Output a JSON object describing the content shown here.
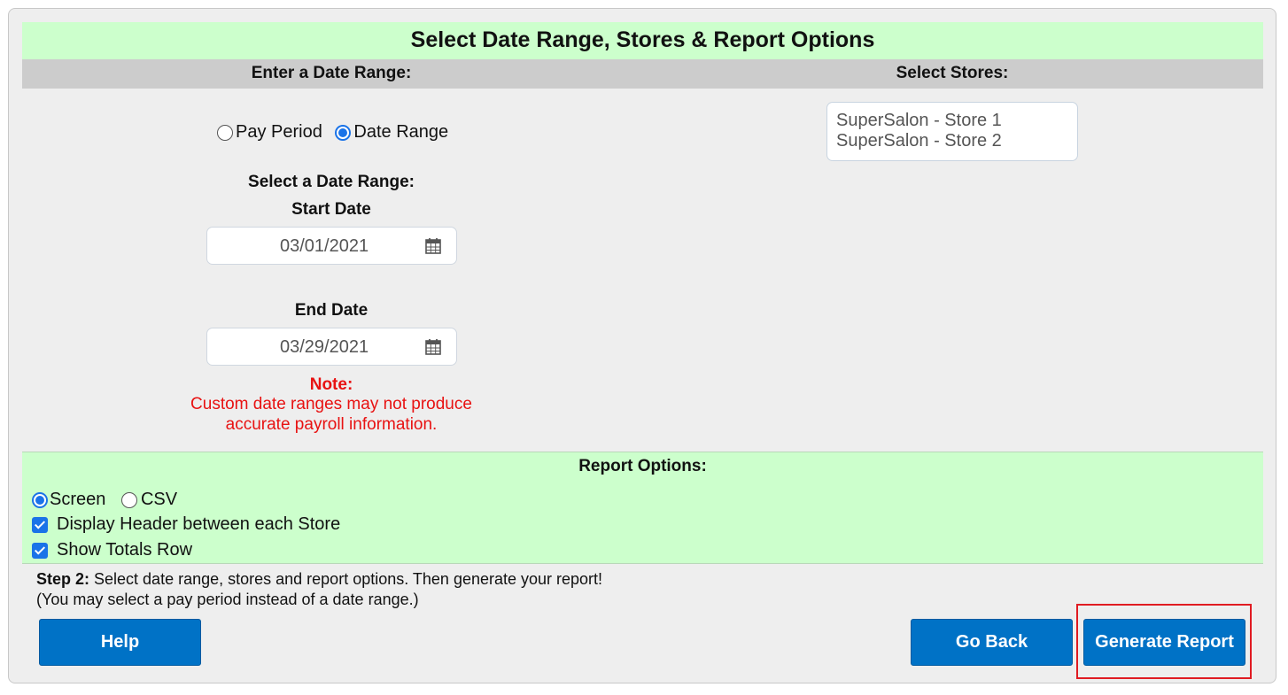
{
  "title": "Select Date Range, Stores & Report Options",
  "date_section": {
    "header": "Enter a Date Range:",
    "mode_options": [
      {
        "label": "Pay Period",
        "selected": false
      },
      {
        "label": "Date Range",
        "selected": true
      }
    ],
    "select_label": "Select a Date Range:",
    "start_label": "Start Date",
    "start_value": "03/01/2021",
    "end_label": "End Date",
    "end_value": "03/29/2021",
    "note_title": "Note:",
    "note_line1": "Custom date ranges may not produce",
    "note_line2": "accurate payroll information.",
    "note_color": "#e81212"
  },
  "stores_section": {
    "header": "Select Stores:",
    "stores": [
      "SuperSalon - Store 1",
      "SuperSalon - Store 2"
    ]
  },
  "report_options": {
    "header": "Report Options:",
    "output_formats": [
      {
        "label": "Screen",
        "selected": true
      },
      {
        "label": "CSV",
        "selected": false
      }
    ],
    "checkboxes": [
      {
        "label": "Display Header between each Store",
        "checked": true
      },
      {
        "label": "Show Totals Row",
        "checked": true
      }
    ]
  },
  "instructions": {
    "step_label": "Step 2:",
    "step_text": " Select date range, stores and report options. Then generate your report!",
    "sub_text": "(You may select a pay period instead of a date range.)"
  },
  "buttons": {
    "help": "Help",
    "go_back": "Go Back",
    "generate": "Generate Report"
  },
  "colors": {
    "title_bg": "#ccffcc",
    "subheader_bg": "#cccccc",
    "button_bg": "#0072c6",
    "highlight_border": "#e01b22"
  }
}
